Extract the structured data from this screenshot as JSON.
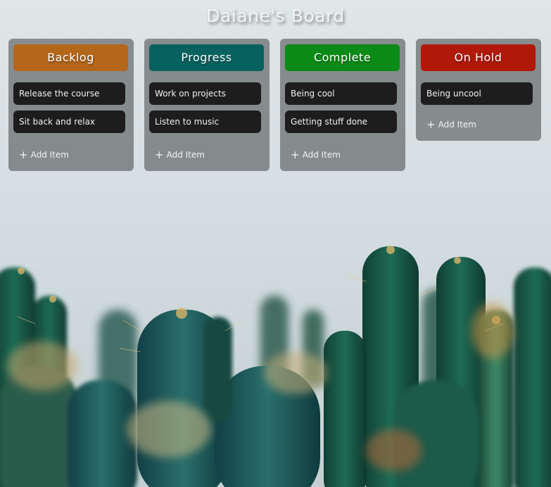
{
  "board": {
    "title": "Daiane's Board"
  },
  "colors": {
    "backlog": "#b4661a",
    "progress": "#06615f",
    "complete": "#0a8a16",
    "on_hold": "#b0190a",
    "item_bg": "#1d1d1d"
  },
  "columns": [
    {
      "name": "Backlog",
      "items": [
        "Release the course",
        "Sit back and relax"
      ],
      "add_label": "Add Item",
      "add_icon": "plus-icon"
    },
    {
      "name": "Progress",
      "items": [
        "Work on projects",
        "Listen to music"
      ],
      "add_label": "Add Item",
      "add_icon": "plus-icon"
    },
    {
      "name": "Complete",
      "items": [
        "Being cool",
        "Getting stuff done"
      ],
      "add_label": "Add Item",
      "add_icon": "plus-icon"
    },
    {
      "name": "On Hold",
      "items": [
        "Being uncool"
      ],
      "add_label": "Add Item",
      "add_icon": "plus-icon"
    }
  ]
}
